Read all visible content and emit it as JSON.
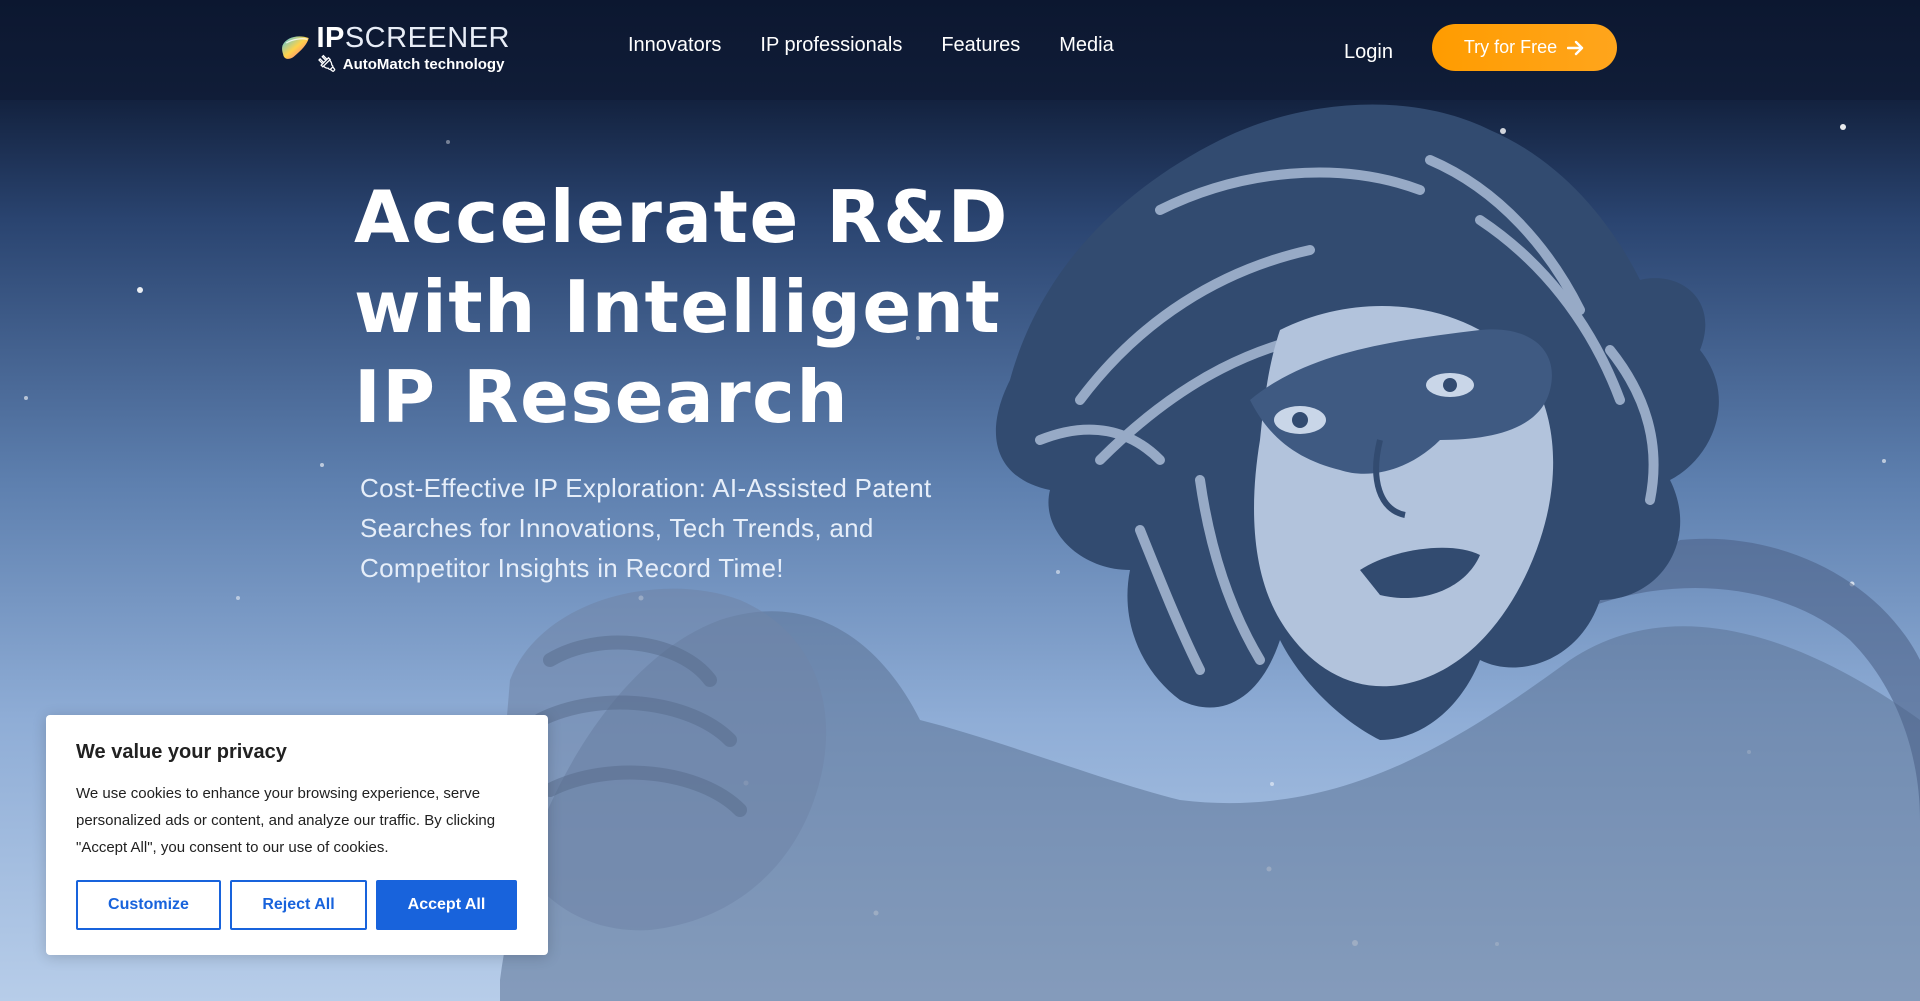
{
  "header": {
    "logo": {
      "name_bold": "IP",
      "name_light": "SCREENER",
      "tagline": "AutoMatch technology",
      "plug_icon": "plug-icon"
    },
    "nav": [
      {
        "label": "Innovators"
      },
      {
        "label": "IP professionals"
      },
      {
        "label": "Features"
      },
      {
        "label": "Media"
      }
    ],
    "login_label": "Login",
    "cta_label": "Try for Free",
    "cta_icon": "arrow-right-icon",
    "cta_color": "#ff9c00"
  },
  "hero": {
    "title_line1": "Accelerate R&D",
    "title_line2": "with Intelligent",
    "title_line3": "IP Research",
    "subtitle_line1": "Cost-Effective IP Exploration: AI-Assisted Patent",
    "subtitle_line2": "Searches for Innovations, Tech Trends, and",
    "subtitle_line3": "Competitor Insights in Record Time!",
    "illustration": "superhero-woman-illustration"
  },
  "cookie_banner": {
    "title": "We value your privacy",
    "text": "We use cookies to enhance your browsing experience, serve personalized ads or content, and analyze our traffic. By clicking \"Accept All\", you consent to our use of cookies.",
    "customize_label": "Customize",
    "reject_label": "Reject All",
    "accept_label": "Accept All",
    "accent_color": "#1863dc"
  }
}
